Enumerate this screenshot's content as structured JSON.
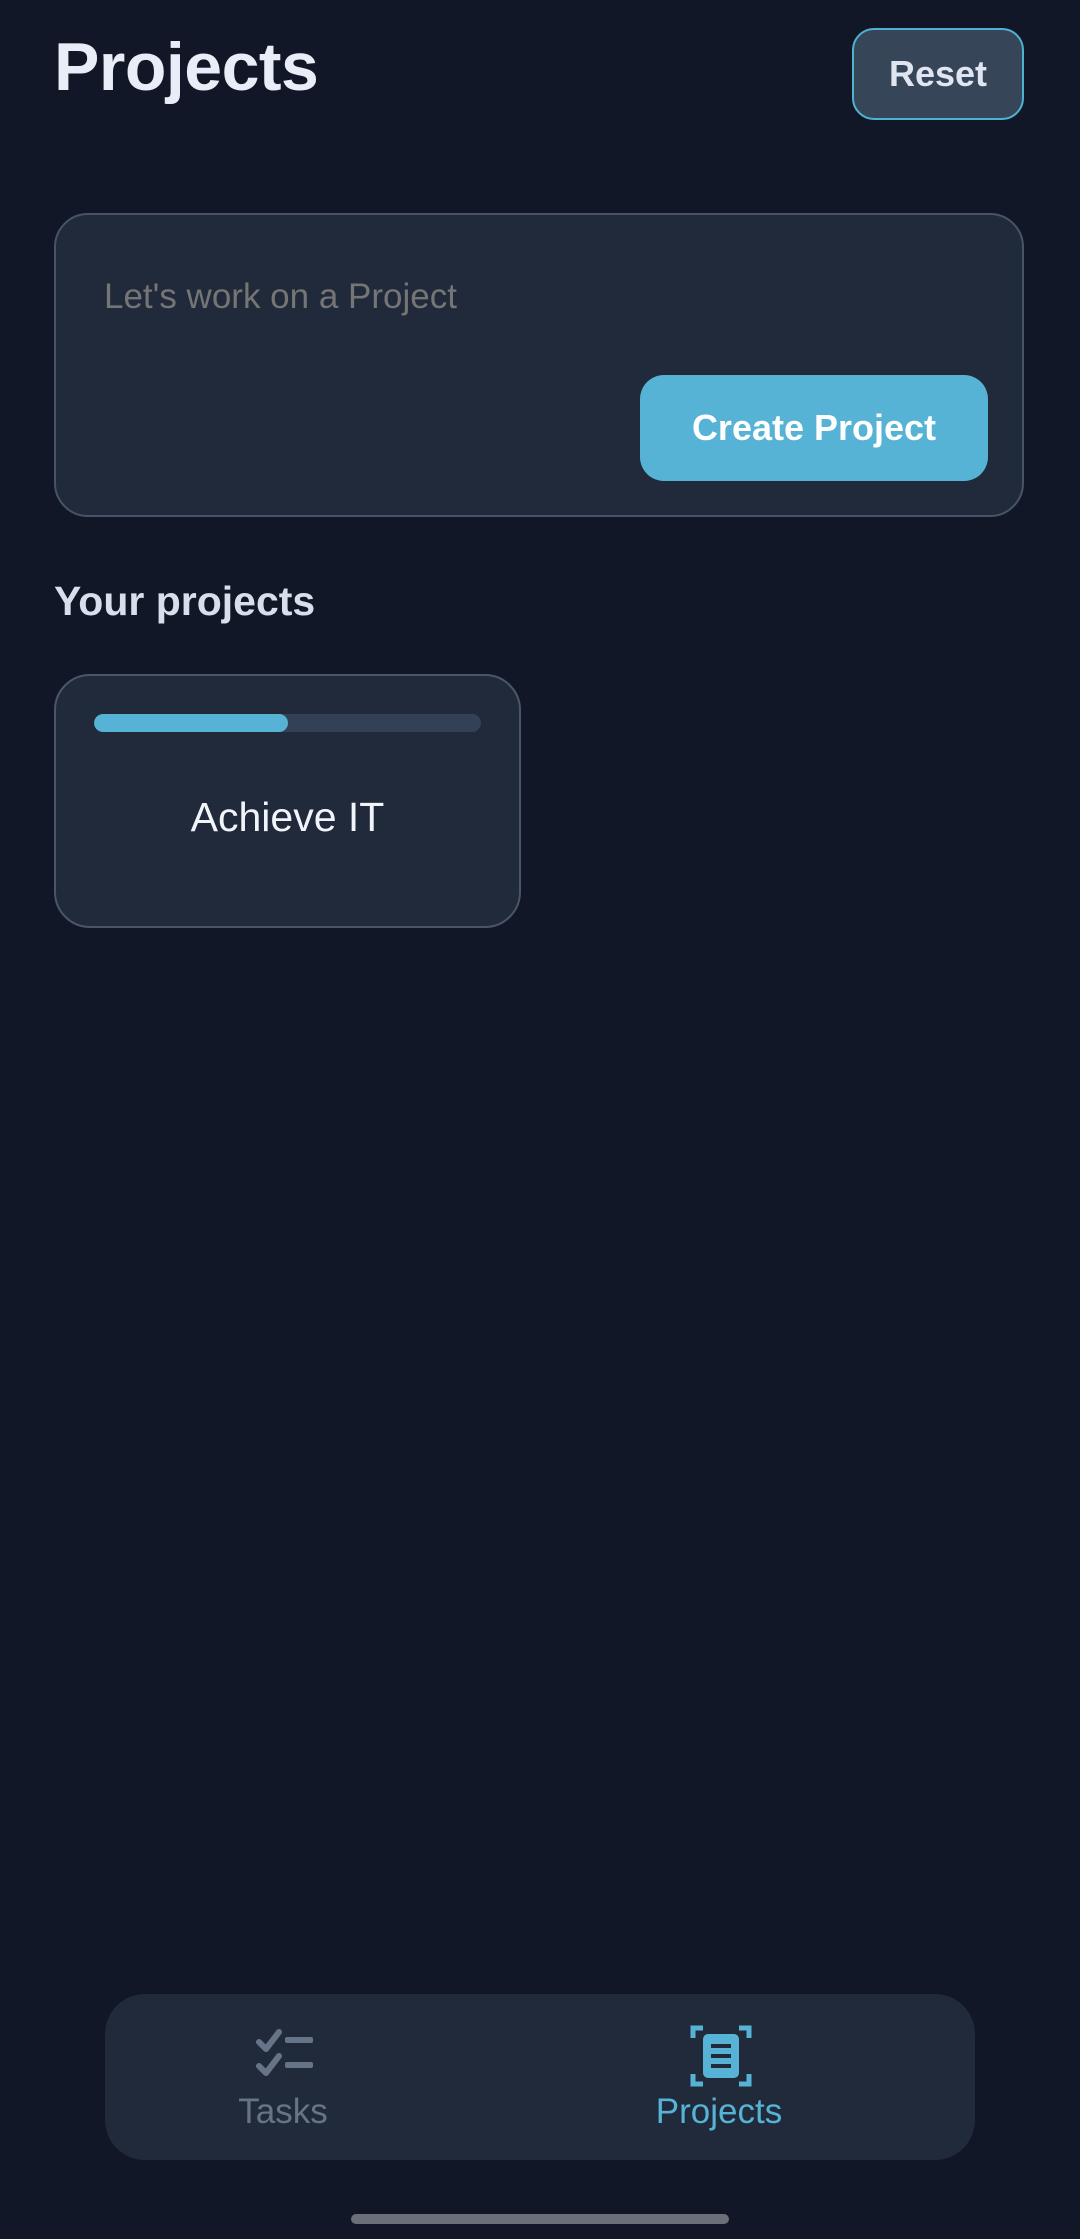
{
  "header": {
    "title": "Projects",
    "reset_label": "Reset"
  },
  "composer": {
    "placeholder": "Let's work on a Project",
    "value": "",
    "create_label": "Create Project"
  },
  "projects_section": {
    "label": "Your projects",
    "items": [
      {
        "name": "Achieve IT",
        "progress_fraction": 0.5
      }
    ]
  },
  "bottom_nav": {
    "items": [
      {
        "label": "Tasks",
        "icon": "checklist-icon",
        "active": false
      },
      {
        "label": "Projects",
        "icon": "document-icon",
        "active": true
      }
    ]
  },
  "colors": {
    "background": "#111727",
    "surface": "#212a3b",
    "accent": "#56b3d5",
    "inactive": "#677386"
  }
}
